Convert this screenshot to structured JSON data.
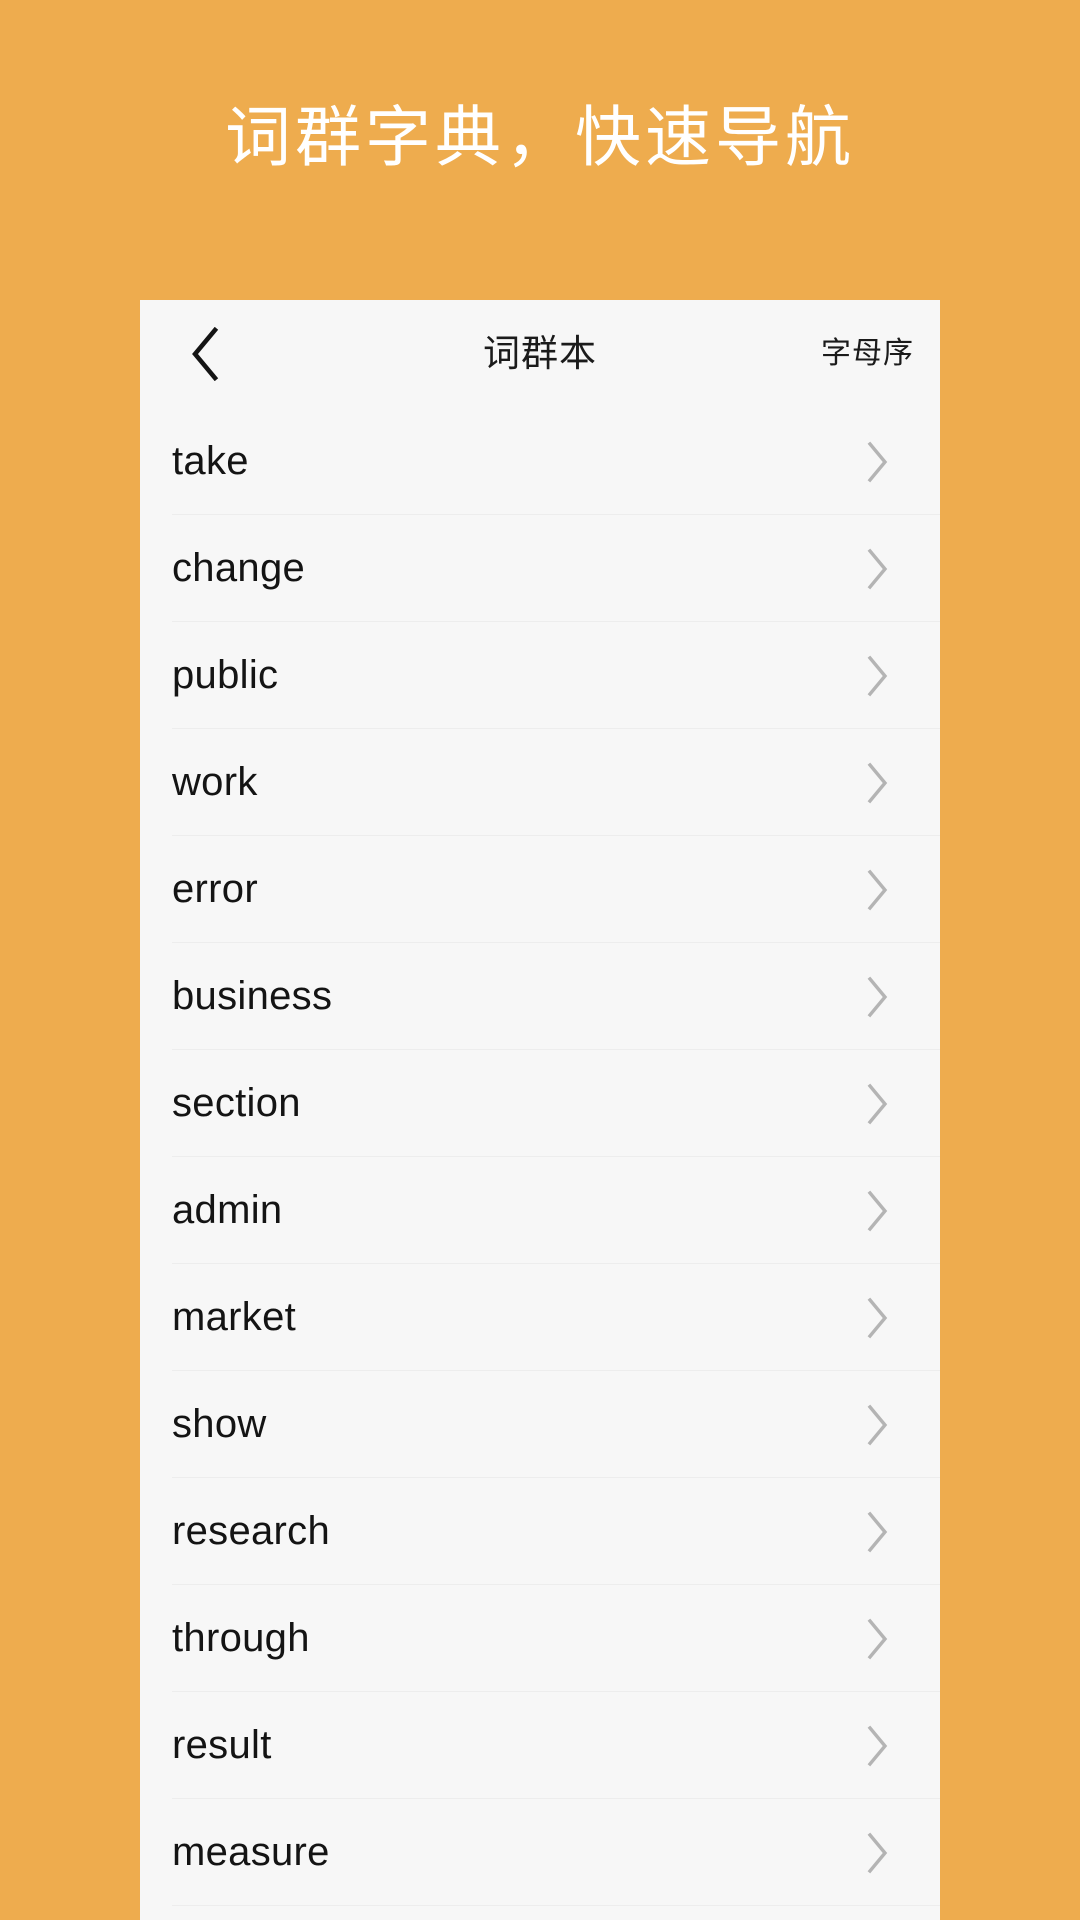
{
  "promo": {
    "background_color": "#eeac4e",
    "headline": "词群字典，快速导航"
  },
  "card": {
    "background_color": "#f7f7f7",
    "nav": {
      "back_icon": "chevron-left-icon",
      "title": "词群本",
      "action_label": "字母序"
    },
    "list": {
      "row_chevron_icon": "chevron-right-icon",
      "items": [
        {
          "word": "take"
        },
        {
          "word": "change"
        },
        {
          "word": "public"
        },
        {
          "word": "work"
        },
        {
          "word": "error"
        },
        {
          "word": "business"
        },
        {
          "word": "section"
        },
        {
          "word": "admin"
        },
        {
          "word": "market"
        },
        {
          "word": "show"
        },
        {
          "word": "research"
        },
        {
          "word": "through"
        },
        {
          "word": "result"
        },
        {
          "word": "measure"
        }
      ]
    }
  }
}
